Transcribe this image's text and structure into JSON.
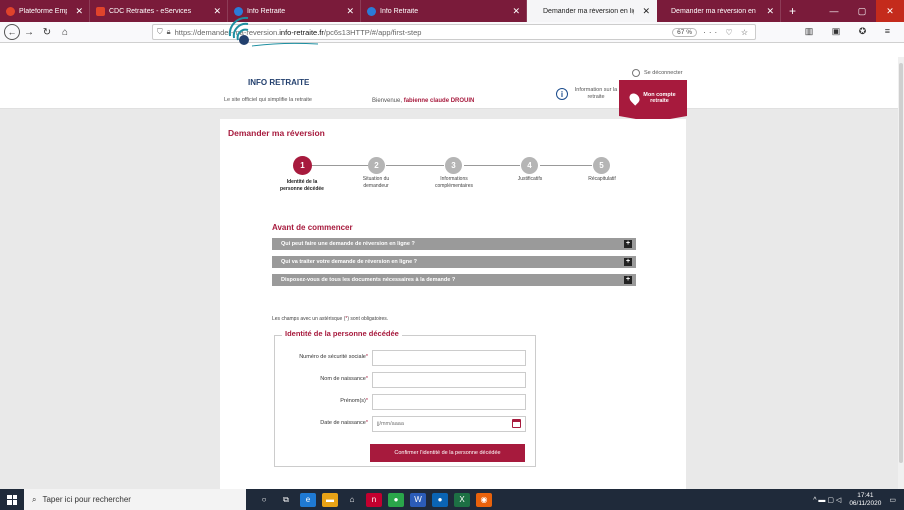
{
  "browser": {
    "tabs": [
      {
        "title": "Plateforme Employeurs Public",
        "fav_color": "#e0432b",
        "active": false
      },
      {
        "title": "CDC Retraites - eServices",
        "fav_color": "#e0432b",
        "active": false
      },
      {
        "title": "Info Retraite",
        "fav_color": "#2b7bd8",
        "active": false
      },
      {
        "title": "Info Retraite",
        "fav_color": "#2b7bd8",
        "active": false
      },
      {
        "title": "Demander ma réversion en lig",
        "fav_color": "",
        "active": true
      },
      {
        "title": "Demander ma réversion en lig",
        "fav_color": "",
        "active": false
      }
    ],
    "url_prefix": "https://demander-ma-reversion.",
    "url_domain": "info-retraite.fr",
    "url_suffix": "/pc6s13HTTP/#/app/first-step",
    "zoom": "67 %"
  },
  "header": {
    "logo_text": "INFO RETRAITE",
    "tagline": "Le site officiel qui simplifie la retraite",
    "greeting_prefix": "Bienvenue,",
    "user_name": "fabienne claude DROUIN",
    "logout": "Se déconnecter",
    "info_label": "Information sur la retraite",
    "account_label": "Mon compte retraite"
  },
  "page": {
    "title": "Demander ma réversion",
    "steps": [
      {
        "num": "1",
        "label": "Identité de la personne décédée"
      },
      {
        "num": "2",
        "label": "Situation du demandeur"
      },
      {
        "num": "3",
        "label": "Informations complémentaires"
      },
      {
        "num": "4",
        "label": "Justificatifs"
      },
      {
        "num": "5",
        "label": "Récapitulatif"
      }
    ],
    "active_step": 1,
    "section_title": "Avant de commencer",
    "accordions": [
      "Qui peut faire une demande de réversion en ligne ?",
      "Qui va traiter votre demande de réversion en ligne ?",
      "Disposez-vous de tous les documents nécessaires à la demande ?"
    ],
    "required_prefix": "Les champs avec un astérisque (",
    "required_ast": "*",
    "required_suffix": ") sont obligatoires.",
    "form_legend": "Identité de la personne décédée",
    "fields": [
      {
        "label": "Numéro de sécurité sociale",
        "placeholder": ""
      },
      {
        "label": "Nom de naissance",
        "placeholder": ""
      },
      {
        "label": "Prénom(s)",
        "placeholder": ""
      },
      {
        "label": "Date de naissance",
        "placeholder": "jj/mm/aaaa"
      }
    ],
    "confirm_button": "Confirmer l'identité de la personne décédée"
  },
  "taskbar": {
    "search_placeholder": "Taper ici pour rechercher",
    "time": "17:41",
    "date": "06/11/2020"
  },
  "colors": {
    "accent": "#a71a3d",
    "tabbar": "#7a1b3a",
    "step_inactive": "#b5b5b5",
    "accordion": "#9a9a9a"
  }
}
